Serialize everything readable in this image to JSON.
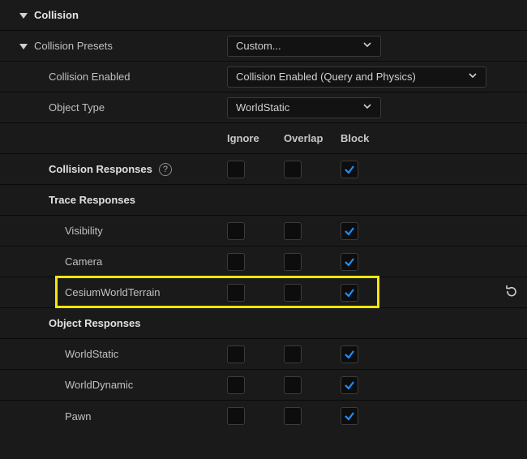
{
  "section": {
    "title": "Collision"
  },
  "presets": {
    "label": "Collision Presets",
    "value": "Custom..."
  },
  "collision_enabled": {
    "label": "Collision Enabled",
    "value": "Collision Enabled (Query and Physics)"
  },
  "object_type": {
    "label": "Object Type",
    "value": "WorldStatic"
  },
  "columns": {
    "ignore": "Ignore",
    "overlap": "Overlap",
    "block": "Block"
  },
  "collision_responses": {
    "label": "Collision Responses"
  },
  "trace_responses": {
    "label": "Trace Responses"
  },
  "object_responses": {
    "label": "Object Responses"
  },
  "rows": {
    "visibility": {
      "label": "Visibility"
    },
    "camera": {
      "label": "Camera"
    },
    "cesium": {
      "label": "CesiumWorldTerrain"
    },
    "world_static": {
      "label": "WorldStatic"
    },
    "world_dynamic": {
      "label": "WorldDynamic"
    },
    "pawn": {
      "label": "Pawn"
    }
  }
}
